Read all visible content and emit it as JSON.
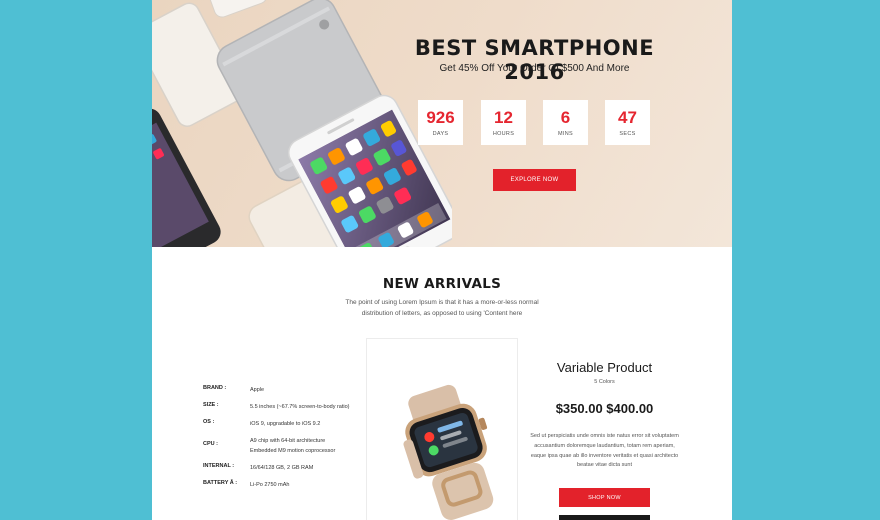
{
  "hero": {
    "title": "BEST SMARTPHONE 2016",
    "subtitle": "Get 45% Off Your Order Of $500 And More",
    "countdown": [
      {
        "value": "926",
        "label": "DAYS"
      },
      {
        "value": "12",
        "label": "HOURS"
      },
      {
        "value": "6",
        "label": "MINS"
      },
      {
        "value": "47",
        "label": "SECS"
      }
    ],
    "cta": "EXPLORE NOW"
  },
  "arrivals": {
    "title": "NEW ARRIVALS",
    "description": "The point of using Lorem Ipsum is that it has a more-or-less normal distribution of letters, as opposed to using 'Content here"
  },
  "specs": [
    {
      "key": "BRAND :",
      "value": "Apple"
    },
    {
      "key": "SIZE :",
      "value": "5.5 inches (~67.7% screen-to-body ratio)"
    },
    {
      "key": "OS :",
      "value": "iOS 9, upgradable to iOS 9.2"
    },
    {
      "key": "CPU :",
      "value": "A9 chip with 64-bit architecture Embedded M9 motion coprocessor"
    },
    {
      "key": "INTERNAL :",
      "value": "16/64/128 GB, 2 GB RAM"
    },
    {
      "key": "BATTERY Â :",
      "value": "Li-Po 2750 mAh"
    }
  ],
  "product": {
    "name": "Variable Product",
    "colors": "5 Colors",
    "price": "$350.00 $400.00",
    "description": "Sed ut perspiciatis unde omnis iste natus error sit voluptatem accusantium doloremque laudantium, totam rem aperiam, eaque ipsa quae ab illo inventore veritatis et quasi architecto beatae vitae dicta sunt",
    "shop_label": "SHOP NOW"
  },
  "colors": {
    "background": "#4fbfd3",
    "accent": "#e3222b",
    "hero_bg": "#ecd8c4",
    "dark": "#1a1a1a"
  }
}
